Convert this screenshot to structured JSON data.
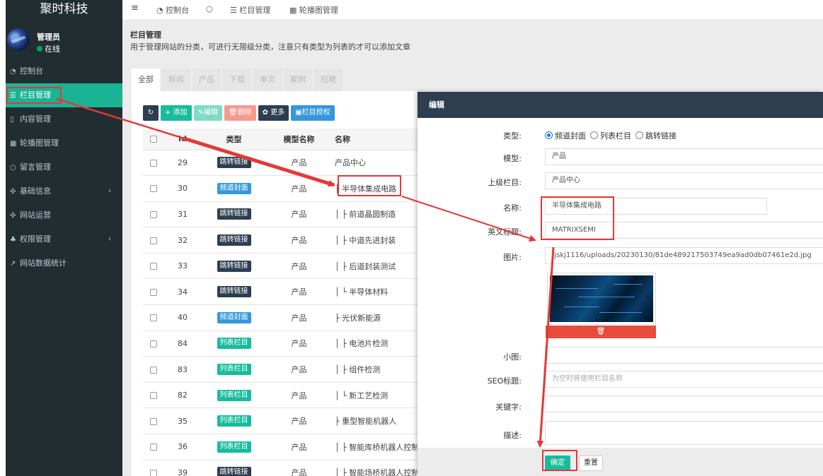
{
  "sidebar": {
    "brand": "聚时科技",
    "user": {
      "name": "管理员",
      "status": "在线"
    },
    "items": [
      {
        "icon": "dashboard-icon",
        "glyph": "◔",
        "label": "控制台"
      },
      {
        "icon": "list-icon",
        "glyph": "☰",
        "label": "栏目管理",
        "active": true
      },
      {
        "icon": "file-icon",
        "glyph": "▯",
        "label": "内容管理"
      },
      {
        "icon": "grid-icon",
        "glyph": "▦",
        "label": "轮播图管理"
      },
      {
        "icon": "comment-icon",
        "glyph": "○",
        "label": "留言管理"
      },
      {
        "icon": "cogs-icon",
        "glyph": "✣",
        "label": "基础信息",
        "chevron": "‹"
      },
      {
        "icon": "cogs-icon",
        "glyph": "✣",
        "label": "网站运营"
      },
      {
        "icon": "users-icon",
        "glyph": "♣",
        "label": "权限管理",
        "chevron": "‹"
      },
      {
        "icon": "chart-icon",
        "glyph": "↗",
        "label": "网站数据统计"
      }
    ]
  },
  "topnav": {
    "menu_glyph": "≡",
    "tabs": [
      {
        "icon": "dashboard-icon",
        "glyph": "◔",
        "label": "控制台"
      },
      {
        "icon": "circle-icon",
        "glyph": "○",
        "label": ""
      },
      {
        "icon": "list-icon",
        "glyph": "☰",
        "label": "栏目管理"
      },
      {
        "icon": "grid-icon",
        "glyph": "▦",
        "label": "轮播图管理"
      }
    ]
  },
  "page": {
    "title": "栏目管理",
    "description": "用于管理网站的分类，可进行无限级分类，注意只有类型为列表的才可以添加文章",
    "tabs": [
      "全部",
      "新闻",
      "产品",
      "下载",
      "单页",
      "案例",
      "招聘"
    ]
  },
  "toolbar": {
    "refresh_glyph": "↻",
    "add": "+ 添加",
    "edit": "✎编辑",
    "delete": "🗑删除",
    "more": "✿ 更多",
    "grant": "▣栏目授权"
  },
  "table": {
    "headers": [
      "Id",
      "类型",
      "模型名称",
      "名称"
    ],
    "rows": [
      {
        "id": "29",
        "type": "跳转链接",
        "kind": "jump",
        "model": "产品",
        "name": "产品中心"
      },
      {
        "id": "30",
        "type": "频道封面",
        "kind": "channel",
        "model": "产品",
        "name": "├ 半导体集成电路"
      },
      {
        "id": "31",
        "type": "跳转链接",
        "kind": "jump",
        "model": "产品",
        "name": "│ ├ 前道晶圆制造"
      },
      {
        "id": "32",
        "type": "跳转链接",
        "kind": "jump",
        "model": "产品",
        "name": "│ ├ 中道先进封装"
      },
      {
        "id": "33",
        "type": "跳转链接",
        "kind": "jump",
        "model": "产品",
        "name": "│ ├ 后道封装测试"
      },
      {
        "id": "34",
        "type": "跳转链接",
        "kind": "jump",
        "model": "产品",
        "name": "│ └ 半导体材料"
      },
      {
        "id": "40",
        "type": "频道封面",
        "kind": "channel",
        "model": "产品",
        "name": "├ 光伏新能源"
      },
      {
        "id": "84",
        "type": "列表栏目",
        "kind": "list",
        "model": "产品",
        "name": "│ ├ 电池片检测"
      },
      {
        "id": "83",
        "type": "列表栏目",
        "kind": "list",
        "model": "产品",
        "name": "│ ├ 组件检测"
      },
      {
        "id": "82",
        "type": "列表栏目",
        "kind": "list",
        "model": "产品",
        "name": "│ └ 新工艺检测"
      },
      {
        "id": "35",
        "type": "列表栏目",
        "kind": "list",
        "model": "产品",
        "name": "├ 重型智能机器人"
      },
      {
        "id": "36",
        "type": "列表栏目",
        "kind": "list",
        "model": "产品",
        "name": "│ ├ 智能库桥机器人控制"
      },
      {
        "id": "39",
        "type": "跳转链接",
        "kind": "jump",
        "model": "产品",
        "name": "│ ├ 智能场桥机器人控制"
      }
    ]
  },
  "modal": {
    "title": "编辑",
    "type_label": "类型:",
    "type_options": [
      "频道封面",
      "列表栏目",
      "跳转链接"
    ],
    "type_selected": 0,
    "model_label": "模型:",
    "model_value": "产品",
    "parent_label": "上级栏目:",
    "parent_value": "产品中心",
    "name_label": "名称:",
    "name_value": "半导体集成电路",
    "eng_label": "英文标题:",
    "eng_value": "MATRIXSEMI",
    "image_label": "图片:",
    "image_value": "/jskj1116/uploads/20230130/81de489217503749ea9ad0db07461e2d.jpg",
    "delete_glyph": "🗑",
    "small_label": "小图:",
    "small_value": "",
    "seo_label": "SEO标题:",
    "seo_placeholder": "为空时将使用栏目名称",
    "keywords_label": "关键字:",
    "keywords_value": "",
    "desc_label": "描述:",
    "desc_value": "",
    "ok": "确定",
    "reset": "重置"
  },
  "colors": {
    "sidebar_bg": "#222d32",
    "accent": "#1ab394",
    "navy": "#2c3e50",
    "blue": "#3498db",
    "danger": "#e74c3c",
    "annotation": "#e53935"
  }
}
